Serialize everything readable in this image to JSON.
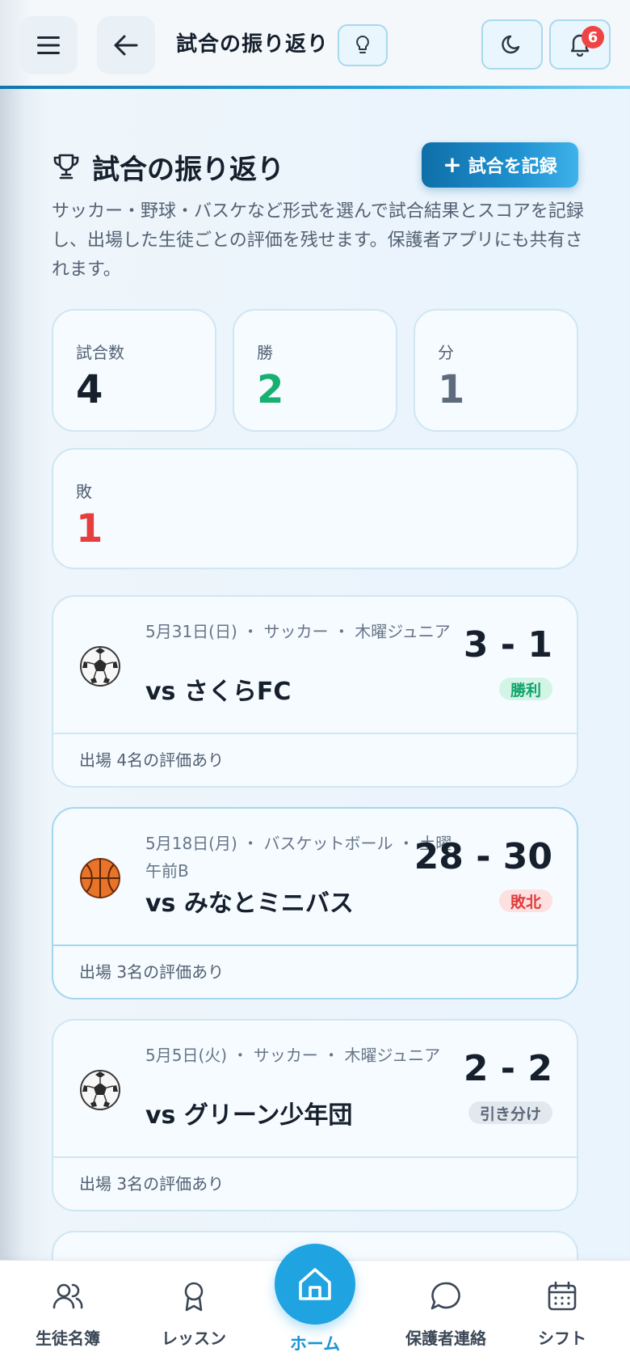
{
  "header": {
    "title": "試合の振り返り",
    "notification_count": "6"
  },
  "page": {
    "title": "試合の振り返り",
    "add_button_label": "試合を記録",
    "description": "サッカー・野球・バスケなど形式を選んで試合結果とスコアを記録し、出場した生徒ごとの評価を残せます。保護者アプリにも共有されます。"
  },
  "stats": {
    "matches": {
      "label": "試合数",
      "value": "4",
      "color": "#16202d"
    },
    "wins": {
      "label": "勝",
      "value": "2",
      "color": "#17b070"
    },
    "draws": {
      "label": "分",
      "value": "1",
      "color": "#5d6b7d"
    },
    "losses": {
      "label": "敗",
      "value": "1",
      "color": "#e53e3e"
    }
  },
  "matches": [
    {
      "icon": "soccer-ball-icon",
      "meta": "5月31日(日) ・ サッカー ・ 木曜ジュニア",
      "opponent": "vs さくらFC",
      "score": "3 - 1",
      "result": "勝利",
      "footer": "出場 4名の評価あり"
    },
    {
      "icon": "basketball-icon",
      "meta": "5月18日(月) ・ バスケットボール ・ 土曜午前B",
      "opponent": "vs みなとミニバス",
      "score": "28 - 30",
      "result": "敗北",
      "footer": "出場 3名の評価あり"
    },
    {
      "icon": "soccer-ball-icon",
      "meta": "5月5日(火) ・ サッカー ・ 木曜ジュニア",
      "opponent": "vs グリーン少年団",
      "score": "2 - 2",
      "result": "引き分け",
      "footer": "出場 3名の評価あり"
    }
  ],
  "nav": {
    "students": "生徒名簿",
    "lessons": "レッスン",
    "home": "ホーム",
    "parent_contact": "保護者連絡",
    "shifts": "シフト"
  },
  "colors": {
    "accent": "#1fa3e1",
    "win": "#10a36b",
    "lose": "#e03c3c",
    "draw": "#5b6878"
  }
}
